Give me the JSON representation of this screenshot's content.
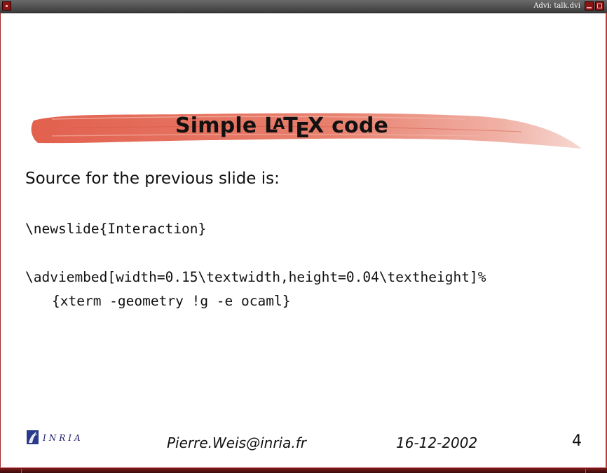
{
  "window": {
    "title": "Advi: talk.dvi",
    "menu_icon": "window-menu-icon",
    "minimize_icon": "minimize-icon",
    "maximize_icon": "maximize-icon"
  },
  "colors": {
    "titlebar": "#4a4a4a",
    "frame_accent": "#9c2c2c",
    "brush": "#e2705e"
  },
  "slide": {
    "title_prefix": "Simple ",
    "latex_logo": "LaTeX",
    "title_suffix": " code",
    "intro": "Source for the previous slide is:",
    "code_lines": [
      "\\newslide{Interaction}",
      "\\adviembed[width=0.15\\textwidth,height=0.04\\textheight]%",
      "{xterm -geometry !g -e ocaml}"
    ]
  },
  "footer": {
    "logo_text": "INRIA",
    "logo_icon": "inria-logo-icon",
    "email": "Pierre.Weis@inria.fr",
    "date": "16-12-2002",
    "page": "4"
  }
}
